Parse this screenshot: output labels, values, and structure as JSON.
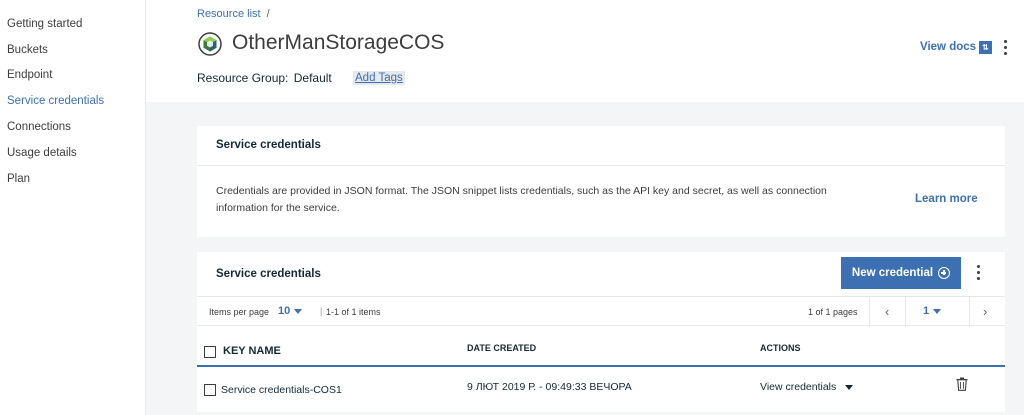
{
  "sidebar": {
    "items": [
      {
        "label": "Getting started",
        "active": false
      },
      {
        "label": "Buckets",
        "active": false
      },
      {
        "label": "Endpoint",
        "active": false
      },
      {
        "label": "Service credentials",
        "active": true
      },
      {
        "label": "Connections",
        "active": false
      },
      {
        "label": "Usage details",
        "active": false
      },
      {
        "label": "Plan",
        "active": false
      }
    ]
  },
  "header": {
    "breadcrumb": {
      "link": "Resource list",
      "separator": "/"
    },
    "title": "OtherManStorageCOS",
    "resource_group_label": "Resource Group:",
    "resource_group_value": "Default",
    "add_tags": "Add Tags",
    "view_docs": "View docs",
    "docs_icon": "arrows-icon"
  },
  "info_card": {
    "title": "Service credentials",
    "description": "Credentials are provided in JSON format. The JSON snippet lists credentials, such as the API key and secret, as well as connection information for the service.",
    "learn_more": "Learn more"
  },
  "credentials_table": {
    "title": "Service credentials",
    "new_button": "New credential",
    "pagination": {
      "items_per_page_label": "Items per page",
      "items_per_page": "10",
      "separator": "|",
      "range": "1-1 of 1 items",
      "pages_of": "1 of 1 pages",
      "current_page": "1",
      "prev": "‹",
      "next": "›"
    },
    "columns": {
      "key_name": "KEY NAME",
      "date_created": "DATE CREATED",
      "actions": "ACTIONS"
    },
    "rows": [
      {
        "key_name": "Service credentials-COS1",
        "date_created": "9 ЛЮТ 2019 Р. - 09:49:33 ВЕЧОРА",
        "action": "View credentials"
      }
    ]
  },
  "colors": {
    "accent": "#3d70b2",
    "background": "#f3f5f7",
    "text": "#152935"
  }
}
